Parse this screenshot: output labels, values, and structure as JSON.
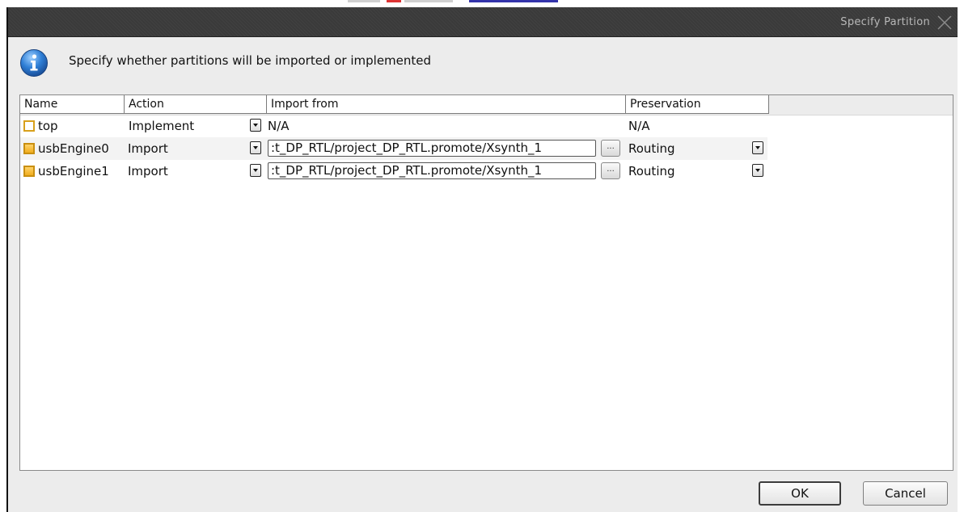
{
  "window": {
    "title": "Specify Partition"
  },
  "message": "Specify whether partitions will be imported or implemented",
  "table": {
    "columns": [
      "Name",
      "Action",
      "Import from",
      "Preservation"
    ],
    "rows": [
      {
        "name": "top",
        "action": "Implement",
        "import_from": "N/A",
        "preservation": "N/A"
      },
      {
        "name": "usbEngine0",
        "action": "Import",
        "import_from": ":t_DP_RTL/project_DP_RTL.promote/Xsynth_1",
        "browse": "...",
        "preservation": "Routing"
      },
      {
        "name": "usbEngine1",
        "action": "Import",
        "import_from": ":t_DP_RTL/project_DP_RTL.promote/Xsynth_1",
        "browse": "...",
        "preservation": "Routing"
      }
    ]
  },
  "buttons": {
    "ok": "OK",
    "cancel": "Cancel"
  },
  "icons": {
    "info": "info-icon",
    "close": "close-icon",
    "partition": "partition-icon",
    "dropdown": "chevron-down-icon"
  },
  "colors": {
    "titlebar": "#3d3d3d",
    "dialog_bg": "#ececec",
    "partition_icon": "#f0ad1e"
  }
}
